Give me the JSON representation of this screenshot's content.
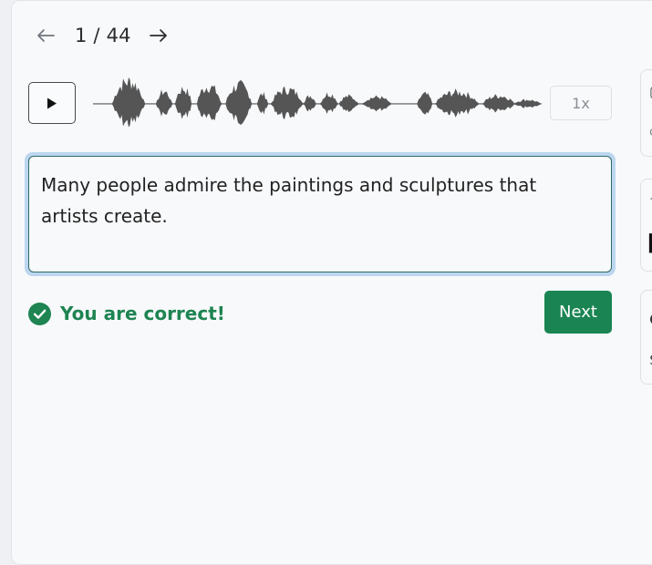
{
  "navigation": {
    "counter": "1 / 44",
    "prev_icon": "arrow-left-icon",
    "next_icon": "arrow-right-icon"
  },
  "player": {
    "play_icon": "play-icon",
    "speed_label": "1x"
  },
  "answer": {
    "text": "Many people admire the paintings and sculptures that artists create."
  },
  "feedback": {
    "message": "You are correct!",
    "icon": "check-circle-icon",
    "color": "#1d8452"
  },
  "actions": {
    "next_label": "Next",
    "next_color": "#1a8553"
  }
}
